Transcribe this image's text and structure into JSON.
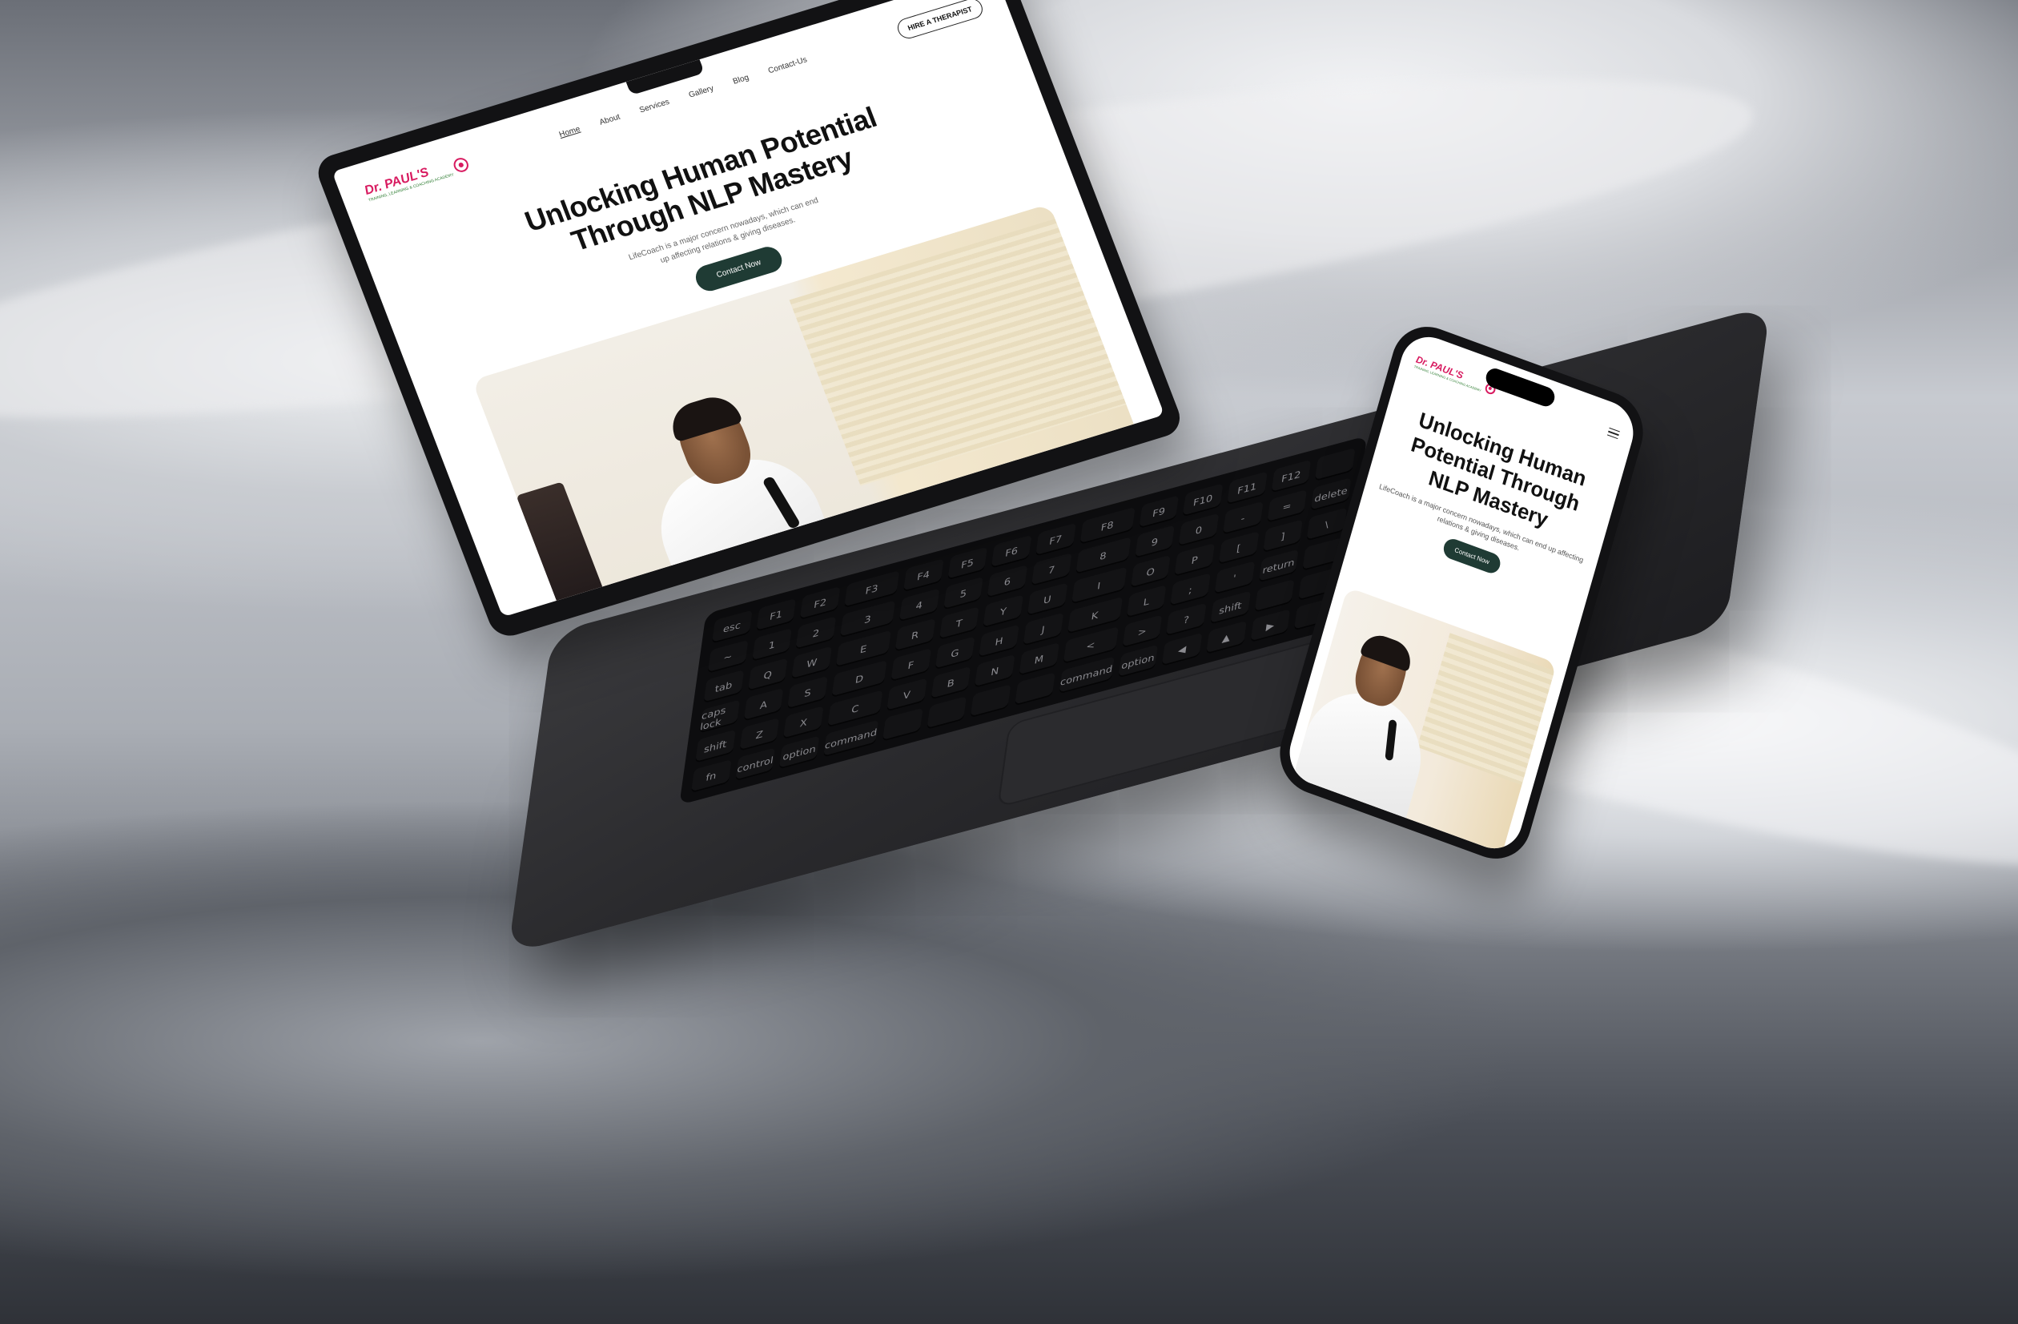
{
  "brand": {
    "name": "Dr. PAUL'S",
    "tagline": "TRAINING, LEARNING & COACHING ACADEMY",
    "colors": {
      "primary": "#d81b60",
      "secondary": "#2e7d32",
      "cta": "#1f3b34"
    }
  },
  "nav": {
    "items": [
      {
        "label": "Home",
        "active": true
      },
      {
        "label": "About"
      },
      {
        "label": "Services"
      },
      {
        "label": "Gallery"
      },
      {
        "label": "Blog"
      },
      {
        "label": "Contact-Us"
      }
    ],
    "hire_button": "HIRE A THERAPIST"
  },
  "hero": {
    "title_line1": "Unlocking Human Potential",
    "title_line2": "Through NLP Mastery",
    "description": "LifeCoach is a major concern nowadays, which can end up affecting relations & giving diseases.",
    "cta": "Contact Now"
  },
  "phone": {
    "title_line1": "Unlocking Human",
    "title_line2": "Potential Through",
    "title_line3": "NLP Mastery",
    "description": "LifeCoach is a major concern nowadays, which can end up affecting relations & giving diseases.",
    "cta": "Contact Now",
    "menu_icon": "hamburger-menu-icon"
  },
  "keyboard": {
    "keys": [
      "esc",
      "F1",
      "F2",
      "F3",
      "F4",
      "F5",
      "F6",
      "F7",
      "F8",
      "F9",
      "F10",
      "F11",
      "F12",
      "",
      "~",
      "1",
      "2",
      "3",
      "4",
      "5",
      "6",
      "7",
      "8",
      "9",
      "0",
      "-",
      "=",
      "delete",
      "tab",
      "Q",
      "W",
      "E",
      "R",
      "T",
      "Y",
      "U",
      "I",
      "O",
      "P",
      "[",
      "]",
      "\\",
      "caps lock",
      "A",
      "S",
      "D",
      "F",
      "G",
      "H",
      "J",
      "K",
      "L",
      ";",
      "'",
      "return",
      "",
      "shift",
      "Z",
      "X",
      "C",
      "V",
      "B",
      "N",
      "M",
      "<",
      ">",
      "?",
      "shift",
      "",
      "",
      "fn",
      "control",
      "option",
      "command",
      "",
      "",
      "",
      "",
      "command",
      "option",
      "◀",
      "▲",
      "▶",
      ""
    ]
  }
}
